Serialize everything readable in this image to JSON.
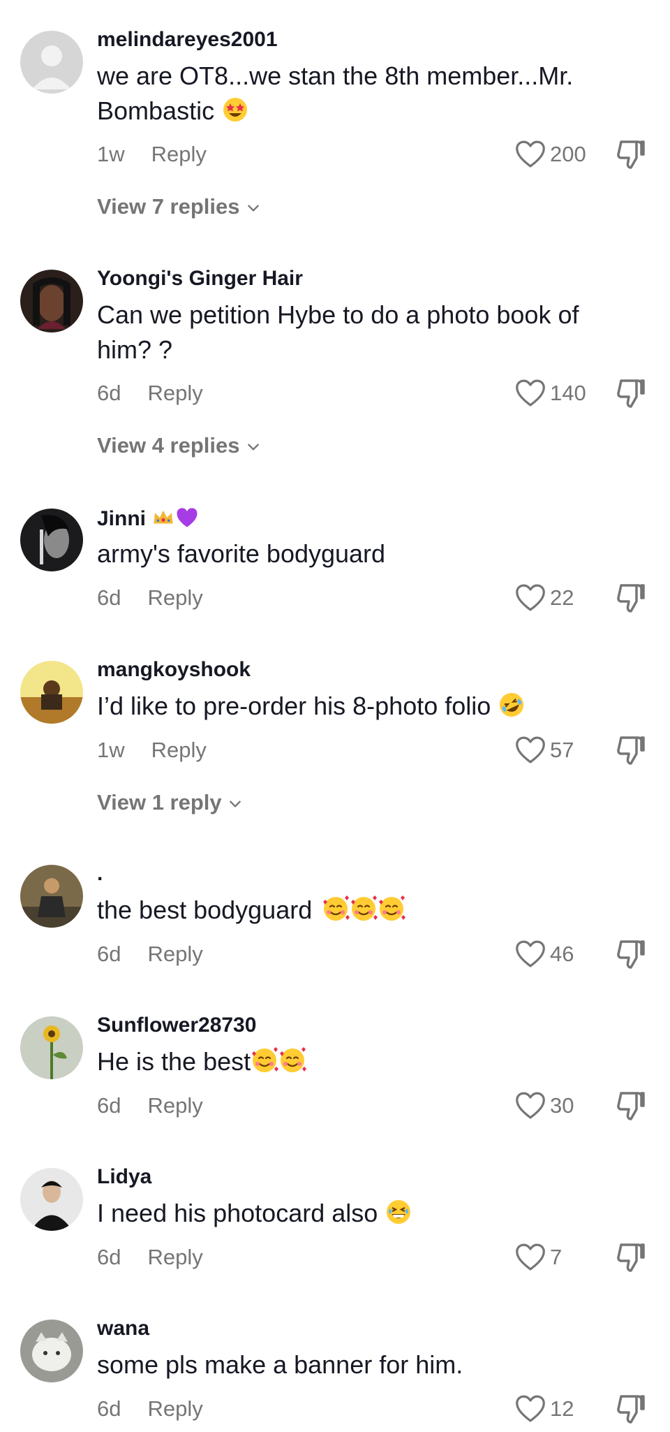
{
  "comments": [
    {
      "username": "melindareyes2001",
      "text": "we are OT8...we stan the 8th member...Mr. Bombastic",
      "emoji": "star-struck",
      "age": "1w",
      "reply_label": "Reply",
      "likes": "200",
      "view_replies": "View 7 replies"
    },
    {
      "username": "Yoongi's Ginger Hair",
      "text": "Can we petition Hybe to do a photo book of him? ?",
      "age": "6d",
      "reply_label": "Reply",
      "likes": "140",
      "view_replies": "View 4 replies"
    },
    {
      "username": "Jinni",
      "username_emoji": "crown-purple-heart",
      "text": "army's favorite bodyguard",
      "age": "6d",
      "reply_label": "Reply",
      "likes": "22"
    },
    {
      "username": "mangkoyshook",
      "text": "I’d like to pre-order his 8-photo folio",
      "emoji": "rolling-on-floor-laughing",
      "age": "1w",
      "reply_label": "Reply",
      "likes": "57",
      "view_replies": "View 1 reply"
    },
    {
      "username": ".",
      "text": "the best bodyguard",
      "emoji": "smiling-face-with-hearts x3",
      "age": "6d",
      "reply_label": "Reply",
      "likes": "46"
    },
    {
      "username": "Sunflower28730",
      "text": "He is the best",
      "emoji": "smiling-face-with-hearts x2",
      "age": "6d",
      "reply_label": "Reply",
      "likes": "30"
    },
    {
      "username": "Lidya",
      "text": "I need his photocard also",
      "emoji": "grinning-squinting-face",
      "age": "6d",
      "reply_label": "Reply",
      "likes": "7"
    },
    {
      "username": "wana",
      "text": "some pls make a banner for him.",
      "age": "6d",
      "reply_label": "Reply",
      "likes": "12"
    }
  ],
  "icons": {
    "like": "heart-outline-icon",
    "dislike": "thumbs-down-icon",
    "expand": "chevron-down-icon"
  },
  "colors": {
    "text": "#161823",
    "secondary": "#757575",
    "background": "#ffffff"
  }
}
